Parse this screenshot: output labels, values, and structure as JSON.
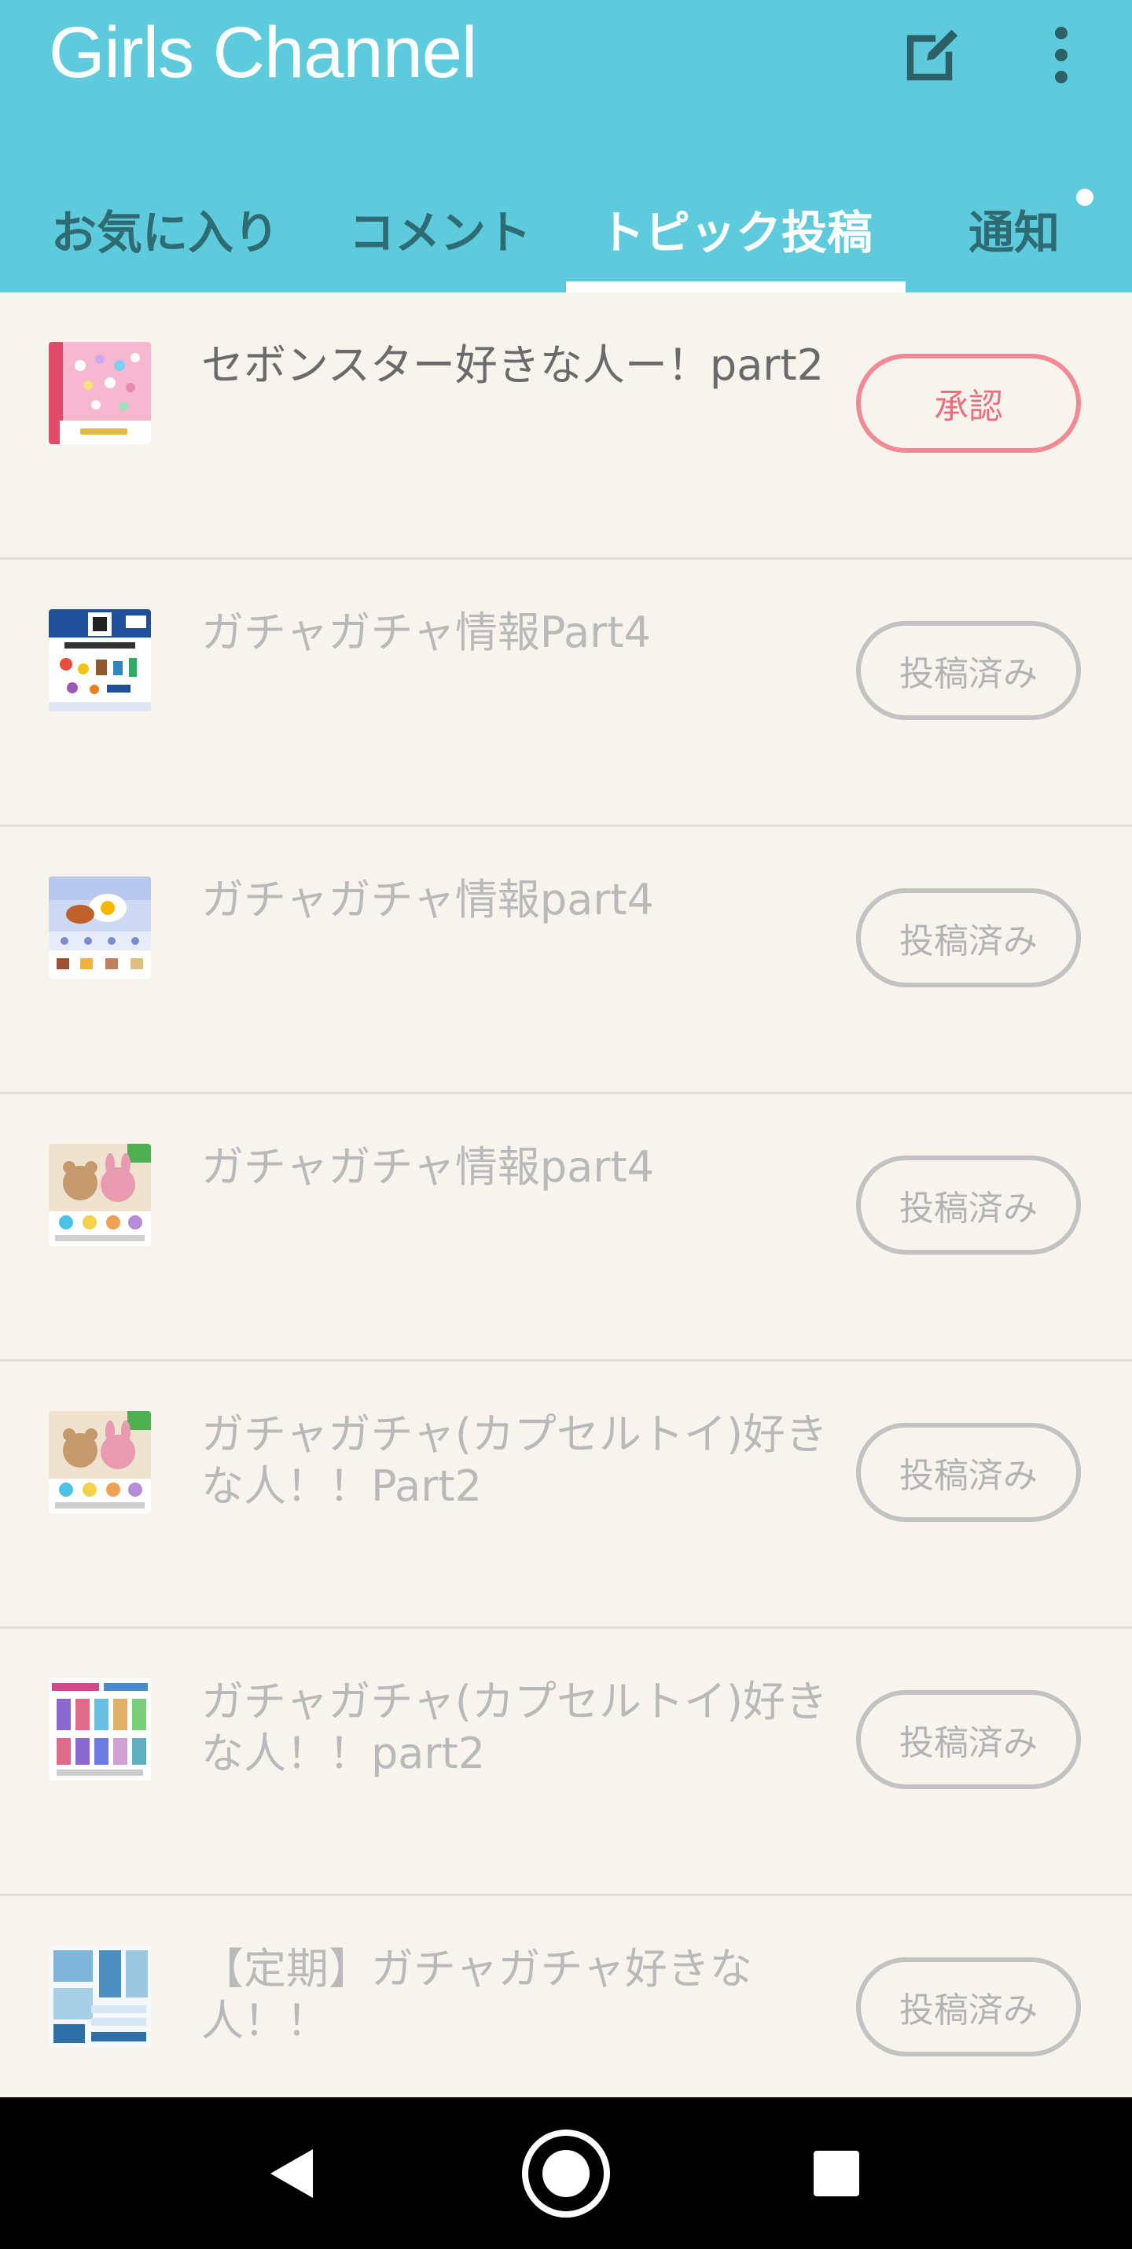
{
  "app": {
    "title": "Girls Channel",
    "icons": {
      "compose": "edit-icon",
      "menu": "more-vertical-icon"
    },
    "colors": {
      "header": "#5ecbdc",
      "background": "#f6f4ec",
      "approve": "#e8707f",
      "posted": "#b3b3b3"
    }
  },
  "tabs": [
    {
      "label": "お気に入り",
      "active": false
    },
    {
      "label": "コメント",
      "active": false
    },
    {
      "label": "トピック投稿",
      "active": true
    },
    {
      "label": "通知",
      "active": false,
      "has_unread_dot": true
    }
  ],
  "topics": [
    {
      "title": "セボンスター好きな人ー！part2",
      "status": "承認",
      "thumbnail": "sebonstar-thumbnail"
    },
    {
      "title": "ガチャガチャ情報Part4",
      "status": "投稿済み",
      "thumbnail": "miniature-mascot-thumbnail"
    },
    {
      "title": "ガチャガチャ情報part4",
      "status": "投稿済み",
      "thumbnail": "food-gacha-thumbnail"
    },
    {
      "title": "ガチャガチャ情報part4",
      "status": "投稿済み",
      "thumbnail": "plush-bears-thumbnail"
    },
    {
      "title": "ガチャガチャ(カプセルトイ)好きな人！！Part2",
      "status": "投稿済み",
      "thumbnail": "plush-bears-thumbnail"
    },
    {
      "title": "ガチャガチャ(カプセルトイ)好きな人！！part2",
      "status": "投稿済み",
      "thumbnail": "anime-figures-thumbnail"
    },
    {
      "title": "【定期】ガチャガチャ好きな人！！",
      "status": "投稿済み",
      "thumbnail": "goods-catalog-thumbnail"
    }
  ],
  "system_nav": {
    "back": "back-triangle-icon",
    "home": "home-circle-icon",
    "recents": "recents-square-icon"
  }
}
